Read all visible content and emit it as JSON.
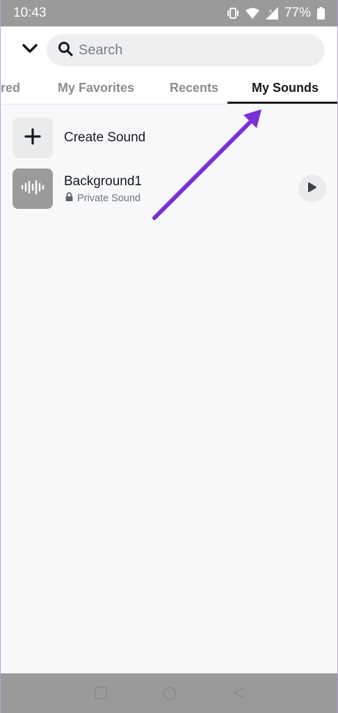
{
  "status_bar": {
    "time": "10:43",
    "battery": "77%",
    "icons": [
      "vibrate-icon",
      "wifi-icon",
      "signal-icon",
      "battery-icon"
    ]
  },
  "header": {
    "collapse_icon": "chevron-down-icon",
    "search": {
      "placeholder": "Search",
      "value": ""
    }
  },
  "tabs": [
    {
      "label": "red",
      "active": false
    },
    {
      "label": "My Favorites",
      "active": false
    },
    {
      "label": "Recents",
      "active": false
    },
    {
      "label": "My Sounds",
      "active": true
    }
  ],
  "list": {
    "create": {
      "label": "Create Sound",
      "icon": "plus-icon"
    },
    "sounds": [
      {
        "title": "Background1",
        "subtitle": "Private Sound",
        "icon": "waveform-icon",
        "privacy_icon": "lock-icon",
        "action_icon": "play-icon"
      }
    ]
  },
  "annotation": {
    "color": "#7b2fd6"
  },
  "nav_bar": {
    "icons": [
      "recents-square-icon",
      "home-circle-icon",
      "back-triangle-icon"
    ]
  }
}
